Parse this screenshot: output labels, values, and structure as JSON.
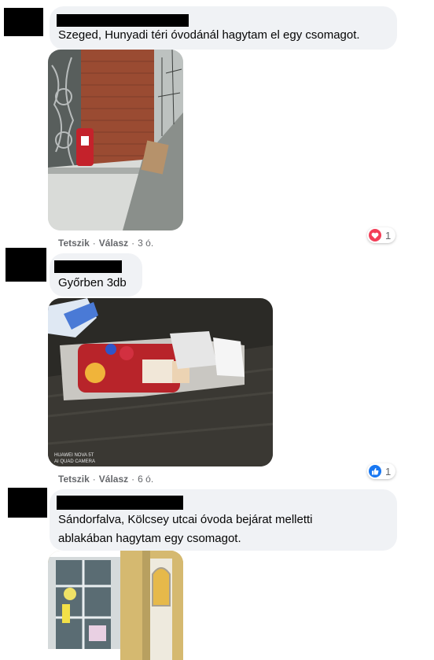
{
  "comments": [
    {
      "text": "Szeged, Hunyadi téri óvodánál hagytam el egy csomagot.",
      "actions": {
        "like": "Tetszik",
        "reply": "Válasz",
        "time": "3 ó."
      },
      "reaction": {
        "icon": "heart-icon",
        "count": "1",
        "color": "#f33e58"
      }
    },
    {
      "text": "Győrben 3db",
      "actions": {
        "like": "Tetszik",
        "reply": "Válasz",
        "time": "6 ó."
      },
      "reaction": {
        "icon": "like-icon",
        "count": "1",
        "color": "#1877f2"
      },
      "watermark": [
        "HUAWEI NOVA 5T",
        "AI QUAD CAMERA"
      ]
    },
    {
      "text": "Sándorfalva, Kölcsey utcai óvoda bejárat melletti\nablakában hagytam egy csomagot."
    }
  ],
  "separator": "·",
  "colors": {
    "bubble": "#f0f2f5",
    "text": "#050505",
    "meta": "#65676b"
  }
}
